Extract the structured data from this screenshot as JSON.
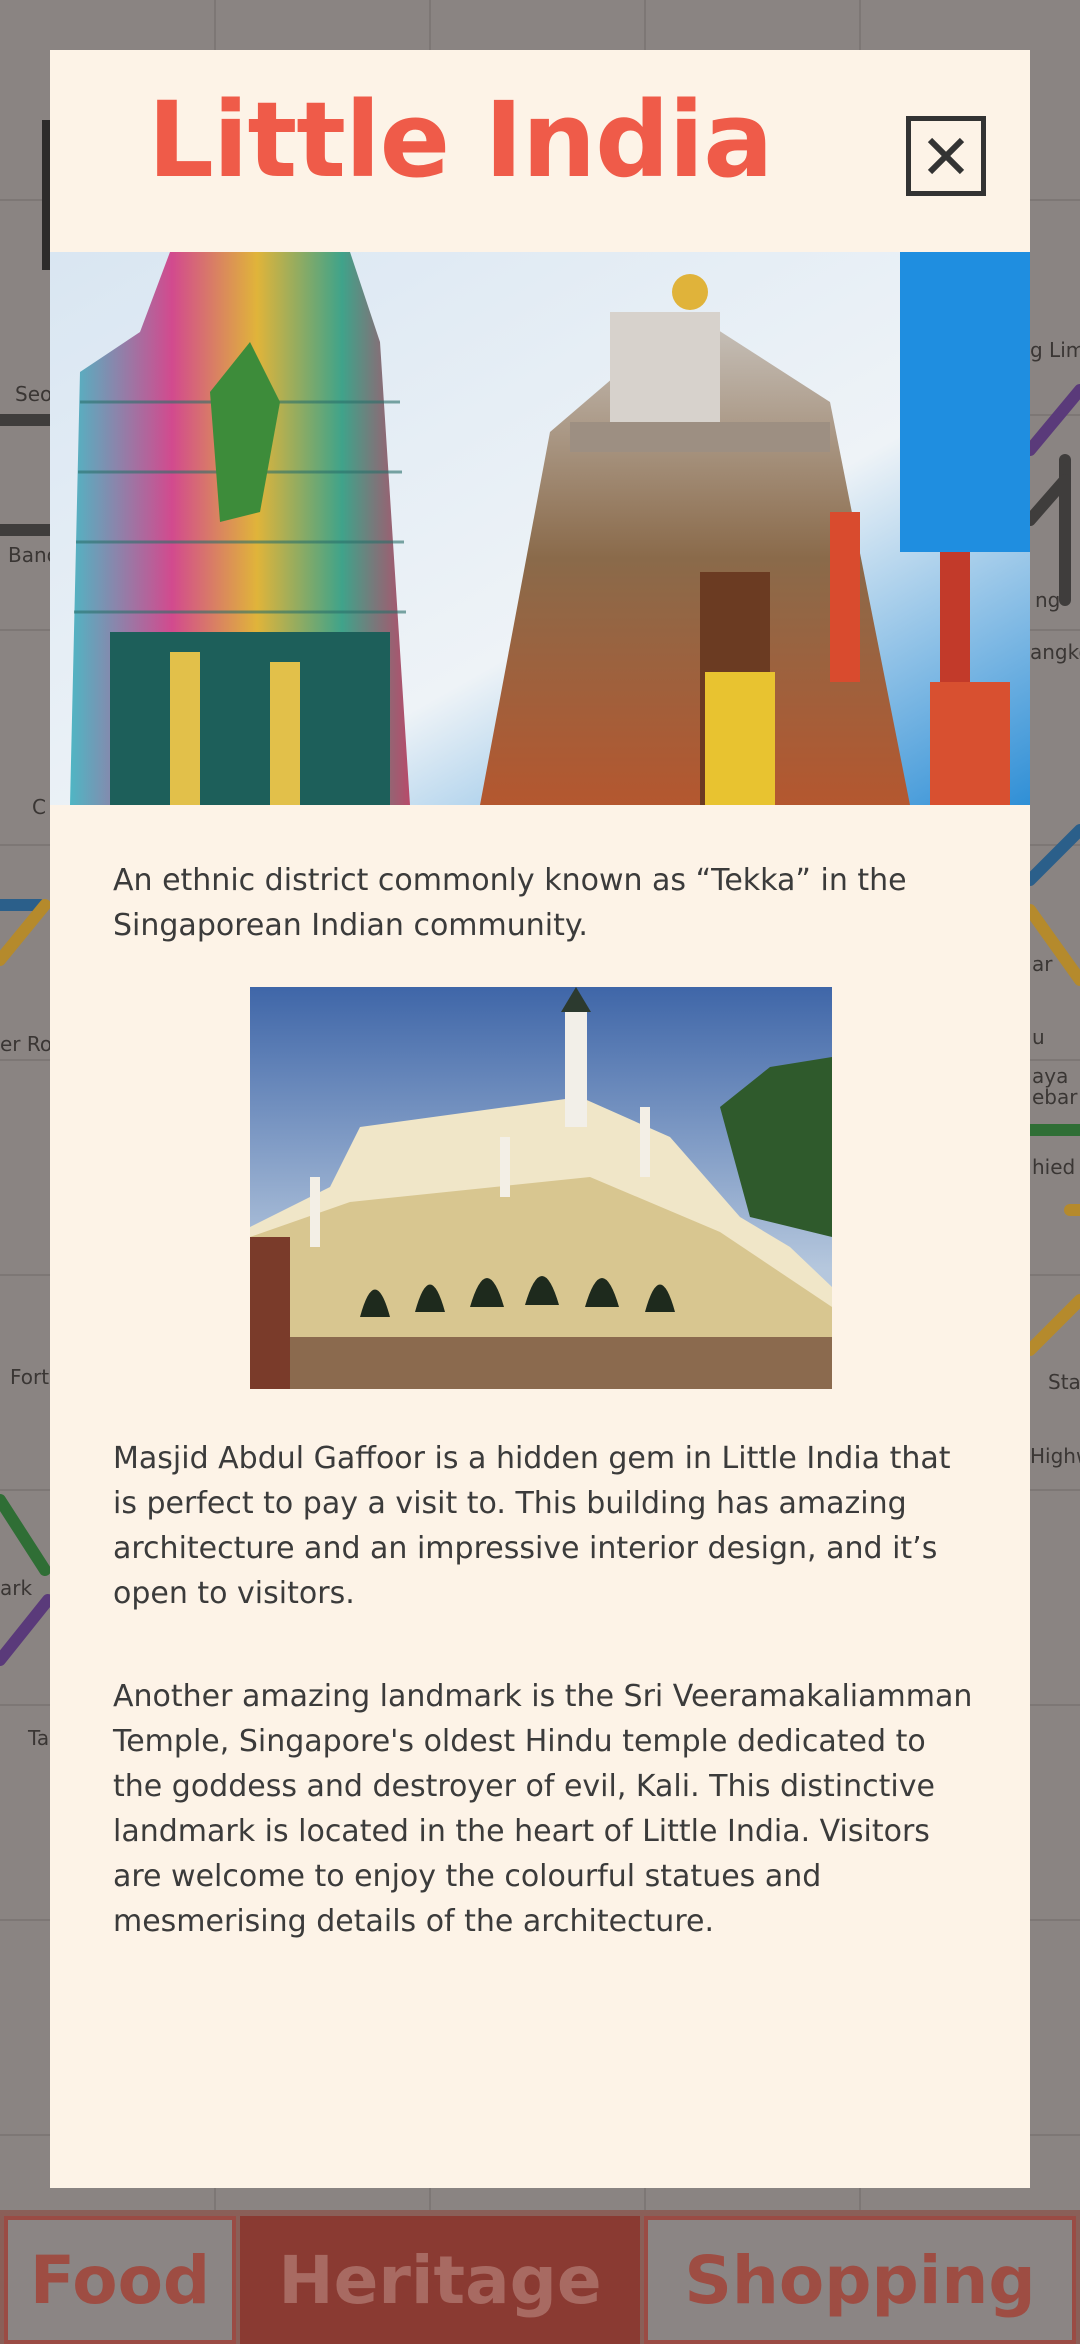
{
  "modal": {
    "title": "Little India",
    "intro": "An ethnic district commonly known as “Tekka” in the Singaporean Indian community.",
    "paragraph_2": "Masjid Abdul Gaffoor is a hidden gem in Little India that is perfect to pay a visit to. This building has amazing architecture and an impressive interior design, and it’s open to visitors.",
    "paragraph_3": "Another amazing landmark is the Sri Veeramakaliamman Temple, Singapore's oldest Hindu temple dedicated to the goddess and destroyer of evil, Kali. This distinctive landmark is located in the heart of Little India. Visitors are welcome to enjoy the colourful statues and mesmerising details of the architecture."
  },
  "icons": {
    "close": "close-icon"
  },
  "tabs": {
    "food": "Food",
    "heritage": "Heritage",
    "shopping": "Shopping"
  },
  "map_labels": {
    "l1": "Seo",
    "l2": "Bano",
    "l3": "C",
    "l4": "er Roa",
    "l5": "Fort",
    "l6": "ark",
    "l7": "Ta",
    "r1": "g Lim",
    "r2": "ng",
    "r3": "angko",
    "r4": "ar",
    "r5": "u",
    "r6": "aya",
    "r7": "ebar",
    "r8": "hied",
    "r9": "Sta",
    "r10": "Highw"
  },
  "colors": {
    "accent": "#ef5b49",
    "modal_bg": "#fdf3e7",
    "active_tab": "#8a3a32"
  }
}
